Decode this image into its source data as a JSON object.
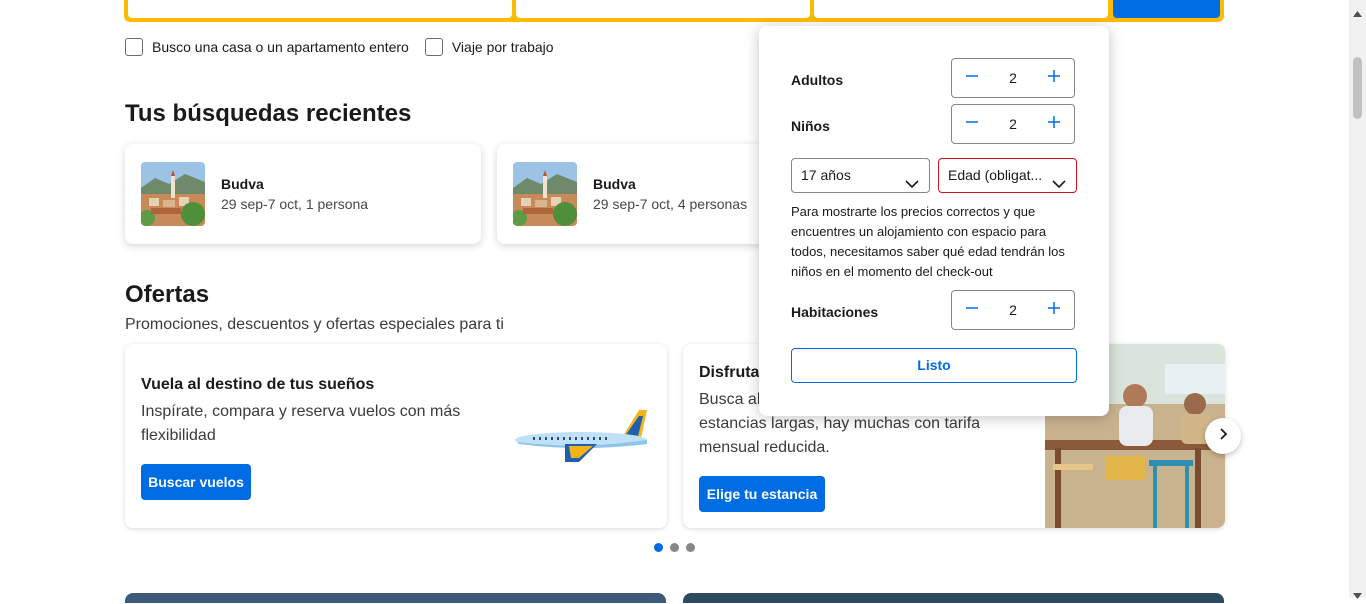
{
  "filters": {
    "whole_home": "Busco una casa o un apartamento entero",
    "work_trip": "Viaje por trabajo"
  },
  "recent": {
    "heading": "Tus búsquedas recientes",
    "items": [
      {
        "name": "Budva",
        "detail": "29 sep-7 oct, 1 persona"
      },
      {
        "name": "Budva",
        "detail": "29 sep-7 oct, 4 personas"
      }
    ]
  },
  "offers": {
    "heading": "Ofertas",
    "subtitle": "Promociones, descuentos y ofertas especiales para ti",
    "cards": [
      {
        "title": "Vuela al destino de tus sueños",
        "text_line1": "Inspírate, compara y reserva vuelos con más",
        "text_line2": "flexibilidad",
        "button": "Buscar vuelos"
      },
      {
        "title": "Disfruta",
        "text_line1": "Busca alo",
        "text_line2": "estancias largas, hay muchas con tarifa",
        "text_line3": "mensual reducida.",
        "button": "Elige tu estancia"
      }
    ]
  },
  "occupancy": {
    "adults_label": "Adultos",
    "adults_value": "2",
    "children_label": "Niños",
    "children_value": "2",
    "child1_age": "17 años",
    "child2_age": "Edad (obligat...",
    "info": "Para mostrarte los precios correctos y que encuentres un alojamiento con espacio para todos, necesitamos saber qué edad tendrán los niños en el momento del check-out",
    "rooms_label": "Habitaciones",
    "rooms_value": "2",
    "done": "Listo"
  },
  "colors": {
    "brand_blue": "#006ce4",
    "search_yellow": "#febb02",
    "error_red": "#d4111e"
  }
}
